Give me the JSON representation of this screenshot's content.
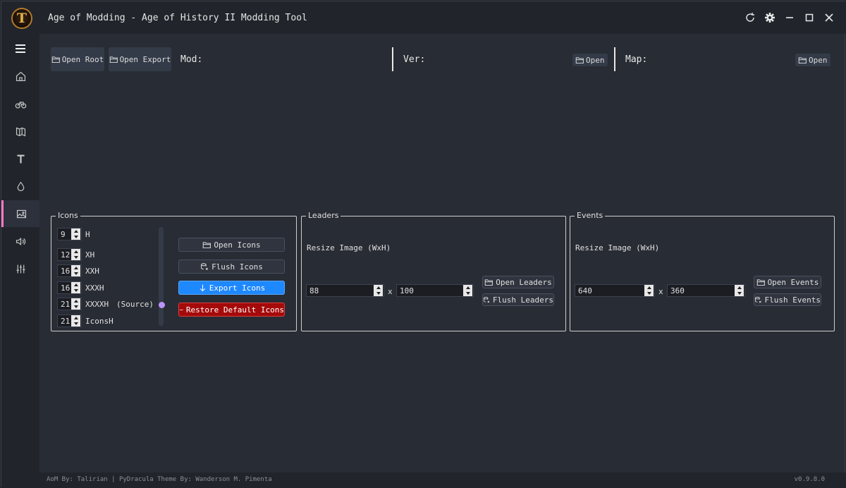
{
  "window": {
    "logo_letter": "T",
    "title": "Age of Modding - Age of History II Modding Tool",
    "icons": [
      "refresh-icon",
      "gear-icon",
      "minimize-icon",
      "maximize-icon",
      "close-icon"
    ]
  },
  "sidebar": {
    "items": [
      {
        "name": "menu-icon"
      },
      {
        "name": "home-icon"
      },
      {
        "name": "bicycle-icon"
      },
      {
        "name": "map-icon"
      },
      {
        "name": "text-icon"
      },
      {
        "name": "drop-icon"
      },
      {
        "name": "image-icon",
        "active": true
      },
      {
        "name": "sound-icon"
      },
      {
        "name": "sliders-icon"
      }
    ]
  },
  "toolbar": {
    "open_root": "Open Root",
    "open_export": "Open Export",
    "mod_label": "Mod:",
    "ver_label": "Ver:",
    "ver_open": "Open",
    "map_label": "Map:",
    "map_open": "Open"
  },
  "icons_panel": {
    "title": "Icons",
    "sizes": [
      {
        "value": "9",
        "label": "H"
      },
      {
        "value": "12",
        "label": "XH"
      },
      {
        "value": "16",
        "label": "XXH"
      },
      {
        "value": "16",
        "label": "XXXH"
      },
      {
        "value": "21",
        "label": "XXXXH",
        "note": "(Source)"
      },
      {
        "value": "21",
        "label": "IconsH"
      }
    ],
    "open_icons": "Open Icons",
    "flush_icons": "Flush Icons",
    "export_icons": "Export Icons",
    "restore_icons": "Restore Default Icons"
  },
  "leaders_panel": {
    "title": "Leaders",
    "resize_label": "Resize Image (WxH)",
    "width": "88",
    "x": "x",
    "height": "100",
    "open": "Open Leaders",
    "flush": "Flush Leaders"
  },
  "events_panel": {
    "title": "Events",
    "resize_label": "Resize Image (WxH)",
    "width": "640",
    "x": "x",
    "height": "360",
    "open": "Open Events",
    "flush": "Flush Events"
  },
  "footer": {
    "credits": "AoM By: Talirian | PyDracula Theme By: Wanderson M. Pimenta",
    "version": "v0.9.8.0"
  }
}
